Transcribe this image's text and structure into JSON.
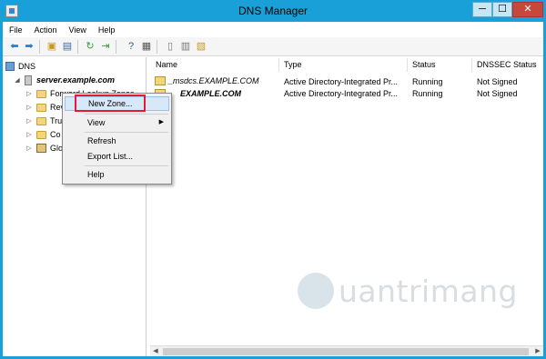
{
  "window": {
    "title": "DNS Manager",
    "controls": {
      "minimize": "─",
      "maximize": "☐",
      "close": "✕"
    }
  },
  "menu": [
    "File",
    "Action",
    "View",
    "Help"
  ],
  "toolbar": [
    "back-arrow-icon",
    "forward-arrow-icon",
    "up-folder-icon",
    "show-hide-tree-icon",
    "refresh-icon",
    "export-icon",
    "help-icon",
    "properties-icon",
    "list-icon",
    "detail-icon",
    "new-folder-icon"
  ],
  "tree": {
    "root": "DNS",
    "server": "server.example.com",
    "children": [
      "Forward Lookup Zones",
      "Rev",
      "Tru",
      "Co",
      "Glo"
    ]
  },
  "list": {
    "columns": [
      "Name",
      "Type",
      "Status",
      "DNSSEC Status"
    ],
    "rows": [
      {
        "name": "_msdcs.EXAMPLE.COM",
        "type": "Active Directory-Integrated Pr...",
        "status": "Running",
        "dnssec": "Not Signed"
      },
      {
        "name": "EXAMPLE.COM",
        "type": "Active Directory-Integrated Pr...",
        "status": "Running",
        "dnssec": "Not Signed"
      }
    ]
  },
  "context_menu": {
    "items": [
      "New Zone...",
      "View",
      "Refresh",
      "Export List...",
      "Help"
    ]
  },
  "watermark": "uantrimang",
  "colors": {
    "titlebar": "#1aa0d8",
    "highlight": "#e81b2c"
  }
}
